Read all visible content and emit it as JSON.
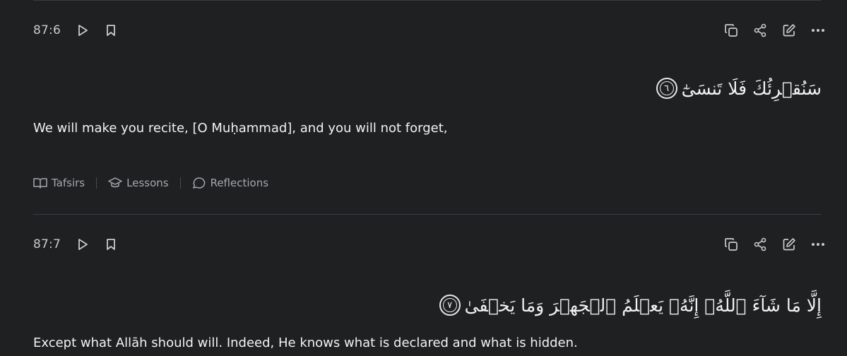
{
  "verses": [
    {
      "key": "87:6",
      "arabic": "سَنُقۡرِئُكَ فَلَا تَنسَىٰٓ",
      "ayah_number": "٦",
      "translation": "We will make you recite, [O Muḥammad], and you will not forget,",
      "tabs": [
        "Tafsirs",
        "Lessons",
        "Reflections"
      ]
    },
    {
      "key": "87:7",
      "arabic": "إِلَّا مَا شَآءَ ٱللَّهُۚ إِنَّهُۥ يَعۡلَمُ ٱلۡجَهۡرَ وَمَا يَخۡفَىٰ",
      "ayah_number": "٧",
      "translation": "Except what Allāh should will. Indeed, He knows what is declared and what is hidden."
    }
  ]
}
